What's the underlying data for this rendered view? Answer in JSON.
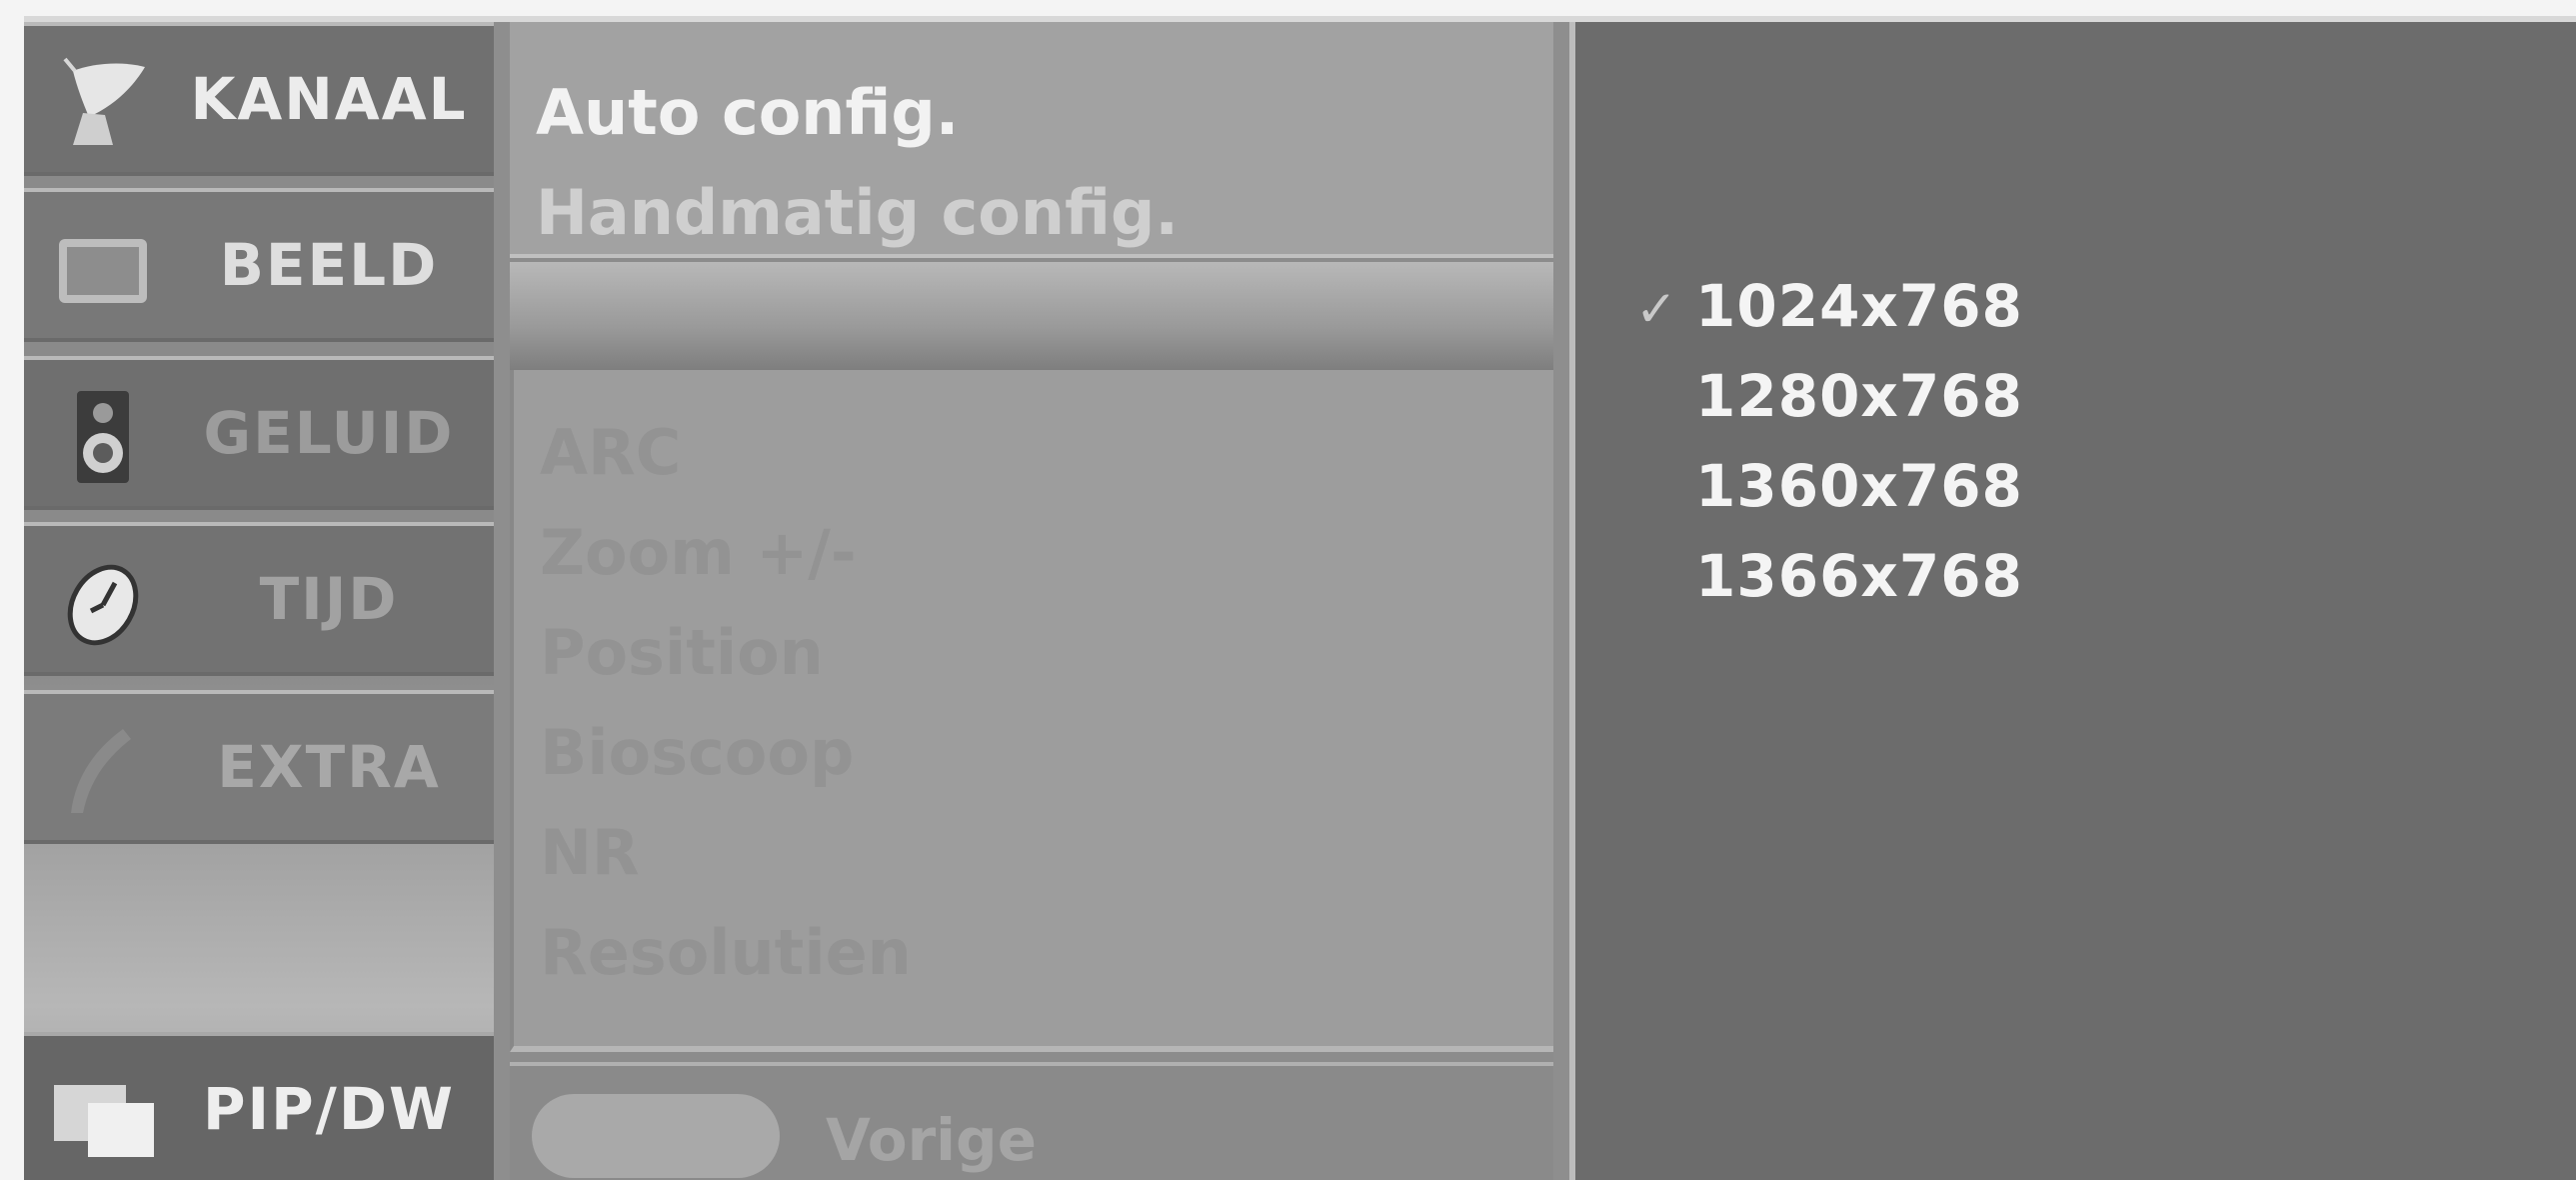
{
  "sidebar": {
    "items": [
      {
        "label": "KANAAL",
        "icon": "satellite-dish-icon"
      },
      {
        "label": "BEELD",
        "icon": "screen-icon"
      },
      {
        "label": "GELUID",
        "icon": "speaker-icon"
      },
      {
        "label": "TIJD",
        "icon": "clock-icon"
      },
      {
        "label": "EXTRA",
        "icon": "extra-icon"
      }
    ],
    "pip": {
      "label": "PIP/DW",
      "icon": "pip-window-icon"
    }
  },
  "middle": {
    "top_options": [
      "Auto config.",
      "Handmatig config."
    ],
    "items": [
      "ARC",
      "Zoom +/-",
      "Position",
      "Bioscoop",
      "NR",
      "Resolutien"
    ],
    "footer": {
      "label": "Vorige"
    }
  },
  "right": {
    "resolutions": [
      {
        "label": "1024x768",
        "selected": true
      },
      {
        "label": "1280x768",
        "selected": false
      },
      {
        "label": "1360x768",
        "selected": false
      },
      {
        "label": "1366x768",
        "selected": false
      }
    ],
    "check_mark": "✓"
  },
  "colors": {
    "osd_background": "#8e8e8e",
    "selected_item": "#707070",
    "text_active": "#f2f2f2",
    "text_dim": "#939393"
  }
}
